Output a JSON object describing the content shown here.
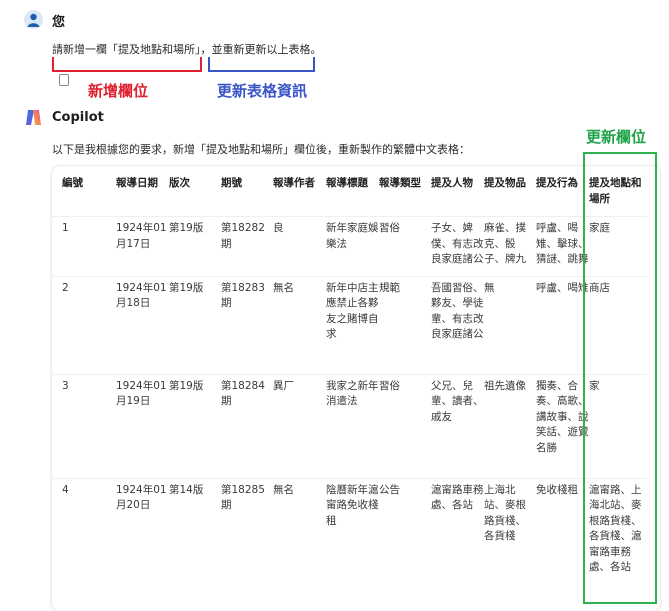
{
  "user": {
    "name": "您",
    "message": "請新增一欄「提及地點和場所」，並重新更新以上表格。"
  },
  "annotations": {
    "new_column": "新增欄位",
    "update_table": "更新表格資訊",
    "updated_column": "更新欄位"
  },
  "copilot": {
    "name": "Copilot",
    "message": "以下是我根據您的要求，新增「提及地點和場所」欄位後，重新製作的繁體中文表格："
  },
  "colors": {
    "red": "#e0202e",
    "blue": "#3a55c8",
    "green": "#2fb24d"
  },
  "table": {
    "headers": [
      "編號",
      "報導日期",
      "版次",
      "期號",
      "報導作者",
      "報導標題",
      "報導類型",
      "提及人物",
      "提及物品",
      "提及行為",
      "提及地點和場所"
    ],
    "rows": [
      [
        "1",
        "1924年01月17日",
        "第19版",
        "第18282期",
        "良",
        "新年家庭娛樂法",
        "習俗",
        "子女、婢僕、有志改良家庭諸公",
        "麻雀、撲克、骰子、牌九",
        "呼盧、喝雉、擊球、猜謎、跳舞",
        "家庭"
      ],
      [
        "2",
        "1924年01月18日",
        "第19版",
        "第18283期",
        "無名",
        "新年中店主應禁止各夥友之賭博自求",
        "規範",
        "吾國習俗、夥友、學徒輩、有志改良家庭諸公",
        "無",
        "呼盧、喝雉",
        "商店"
      ],
      [
        "3",
        "1924年01月19日",
        "第19版",
        "第18284期",
        "異厂",
        "我家之新年消遣法",
        "習俗",
        "父兄、兒輩、讀者、戚友",
        "祖先遺像",
        "獨奏、合奏、高歌、講故事、說笑話、遊覽名勝",
        "家"
      ],
      [
        "4",
        "1924年01月20日",
        "第14版",
        "第18285期",
        "無名",
        "陰曆新年滬甯路免收棧租",
        "公告",
        "滬甯路車務處、各站",
        "上海北站、麥根路貨棧、各貨棧",
        "免收棧租",
        "滬甯路、上海北站、麥根路貨棧、各貨棧、滬甯路車務處、各站"
      ]
    ]
  }
}
